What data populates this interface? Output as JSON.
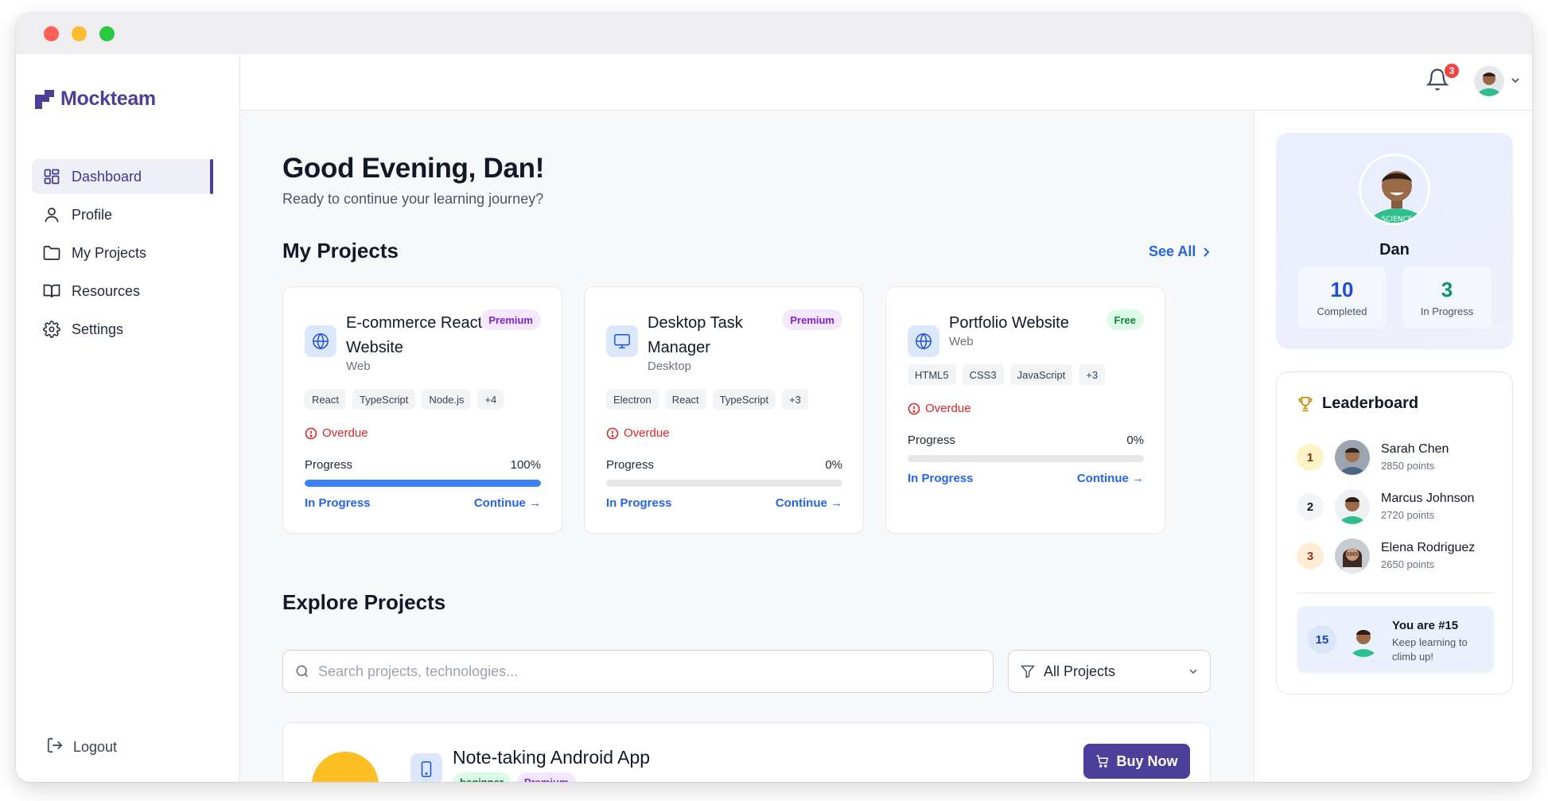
{
  "brand": {
    "name": "Mockteam",
    "color": "#4c3f99"
  },
  "nav": {
    "items": [
      {
        "label": "Dashboard",
        "icon": "dashboard-icon",
        "active": true
      },
      {
        "label": "Profile",
        "icon": "user-icon",
        "active": false
      },
      {
        "label": "My Projects",
        "icon": "folder-icon",
        "active": false
      },
      {
        "label": "Resources",
        "icon": "book-icon",
        "active": false
      },
      {
        "label": "Settings",
        "icon": "gear-icon",
        "active": false
      }
    ],
    "logout": "Logout"
  },
  "topbar": {
    "notifications_count": "3"
  },
  "greeting": {
    "title": "Good Evening, Dan!",
    "subtitle": "Ready to continue your learning journey?"
  },
  "my_projects": {
    "title": "My Projects",
    "see_all": "See All",
    "cards": [
      {
        "title": "E-commerce React Website",
        "category": "Web",
        "icon": "globe-icon",
        "badge": "Premium",
        "tags": [
          "React",
          "TypeScript",
          "Node.js",
          "+4"
        ],
        "overdue": "Overdue",
        "progress_label": "Progress",
        "progress_value": "100%",
        "progress": 1.0,
        "status": "In Progress",
        "action": "Continue →"
      },
      {
        "title": "Desktop Task Manager",
        "category": "Desktop",
        "icon": "monitor-icon",
        "badge": "Premium",
        "tags": [
          "Electron",
          "React",
          "TypeScript",
          "+3"
        ],
        "overdue": "Overdue",
        "progress_label": "Progress",
        "progress_value": "0%",
        "progress": 0.0,
        "status": "In Progress",
        "action": "Continue →"
      },
      {
        "title": "Portfolio Website",
        "category": "Web",
        "icon": "globe-icon",
        "badge": "Free",
        "tags": [
          "HTML5",
          "CSS3",
          "JavaScript",
          "+3"
        ],
        "overdue": "Overdue",
        "progress_label": "Progress",
        "progress_value": "0%",
        "progress": 0.0,
        "status": "In Progress",
        "action": "Continue →"
      }
    ]
  },
  "explore": {
    "title": "Explore Projects",
    "search_placeholder": "Search projects, technologies...",
    "filter_value": "All Projects",
    "project": {
      "title": "Note-taking Android App",
      "level": "beginner",
      "badge": "Premium",
      "buy": "Buy Now",
      "icon": "phone-icon"
    }
  },
  "profile": {
    "name": "Dan",
    "completed": "10",
    "completed_label": "Completed",
    "in_progress": "3",
    "in_progress_label": "In Progress"
  },
  "leaderboard": {
    "title": "Leaderboard",
    "entries": [
      {
        "rank": "1",
        "name": "Sarah Chen",
        "points": "2850 points"
      },
      {
        "rank": "2",
        "name": "Marcus Johnson",
        "points": "2720 points"
      },
      {
        "rank": "3",
        "name": "Elena Rodriguez",
        "points": "2650 points"
      }
    ],
    "you": {
      "rank": "15",
      "title": "You are #15",
      "subtitle": "Keep learning to climb up!"
    }
  },
  "colors": {
    "accent": "#4c3f99",
    "link": "#2563eb",
    "danger": "#dc2626",
    "progress": "#3b82f6",
    "stat_blue": "#1d4ed8",
    "stat_green": "#059669"
  }
}
